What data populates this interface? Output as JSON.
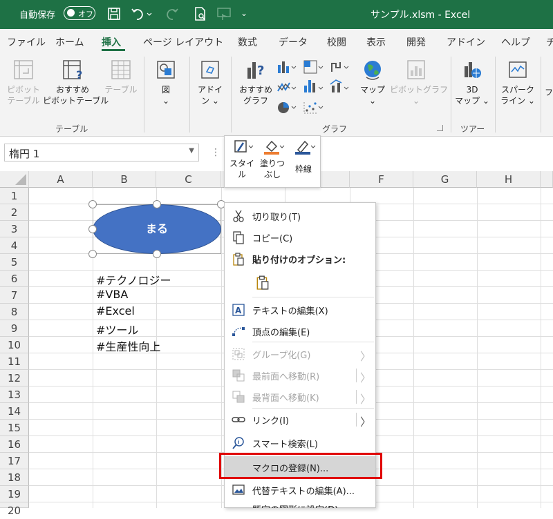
{
  "titlebar": {
    "autosave_label": "自動保存",
    "autosave_state": "オフ",
    "filename": "サンプル.xlsm  -  Excel",
    "bg_color": "#1e7145"
  },
  "tabs": [
    {
      "label": "ファイル"
    },
    {
      "label": "ホーム"
    },
    {
      "label": "挿入"
    },
    {
      "label": "ページ レイアウト"
    },
    {
      "label": "数式"
    },
    {
      "label": "データ"
    },
    {
      "label": "校閲"
    },
    {
      "label": "表示"
    },
    {
      "label": "開発"
    },
    {
      "label": "アドイン"
    },
    {
      "label": "ヘルプ"
    },
    {
      "label": "チ"
    }
  ],
  "active_tab": "挿入",
  "ribbon": {
    "pivot_line1": "ピボット",
    "pivot_line2": "テーブル",
    "rec_pivot_line1": "おすすめ",
    "rec_pivot_line2": "ピボットテーブル",
    "table": "テーブル",
    "illust_line1": "図",
    "illust_line2": "⌄",
    "addin_line1": "アドイ",
    "addin_line2": "ン ⌄",
    "rec_chart_line1": "おすすめ",
    "rec_chart_line2": "グラフ",
    "map_line1": "マップ",
    "map_line2": "⌄",
    "pivot_chart_line1": "ピボットグラフ",
    "pivot_chart_line2": "⌄",
    "map3d_line1": "3D",
    "map3d_line2": "マップ ⌄",
    "sparkline_line1": "スパーク",
    "sparkline_line2": "ライン ⌄",
    "filter_partial": "フ",
    "group_table": "テーブル",
    "group_chart": "グラフ",
    "group_tour": "ツアー"
  },
  "namebox": {
    "value": "楕円 1"
  },
  "mini_toolbar": {
    "style_line1": "スタイ",
    "style_line2": "ル",
    "fill_line1": "塗りつ",
    "fill_line2": "ぶし",
    "outline": "枠線"
  },
  "columns": [
    "A",
    "B",
    "C",
    "D",
    "E",
    "F",
    "G",
    "H"
  ],
  "rows": [
    "1",
    "2",
    "3",
    "4",
    "5",
    "6",
    "7",
    "8",
    "9",
    "10",
    "11",
    "12",
    "13",
    "14",
    "15",
    "16",
    "17",
    "18",
    "19",
    "20"
  ],
  "cells": {
    "b6": "#テクノロジー",
    "b7": "#VBA",
    "b8": "#Excel",
    "b9": "#ツール",
    "b10": "#生産性向上"
  },
  "shape": {
    "label": "まる",
    "fill_color": "#4472c4"
  },
  "context_menu": {
    "cut": "切り取り(T)",
    "copy": "コピー(C)",
    "paste_options": "貼り付けのオプション:",
    "edit_text": "テキストの編集(X)",
    "edit_points": "頂点の編集(E)",
    "group": "グループ化(G)",
    "bring_front": "最前面へ移動(R)",
    "send_back": "最背面へ移動(K)",
    "link": "リンク(I)",
    "smart_lookup": "スマート検索(L)",
    "assign_macro": "マクロの登録(N)...",
    "edit_alt_text": "代替テキストの編集(A)...",
    "set_default_shape": "既定の図形に設定(D)"
  },
  "highlight_color": "#e00000"
}
